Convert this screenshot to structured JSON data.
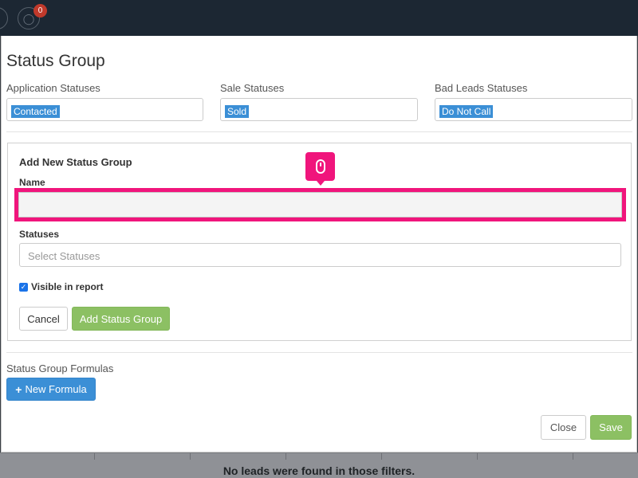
{
  "topbar": {
    "notification_count": "0"
  },
  "modal": {
    "title": "Status Group",
    "status_columns": [
      {
        "label": "Application Statuses",
        "tag": "Contacted"
      },
      {
        "label": "Sale Statuses",
        "tag": "Sold"
      },
      {
        "label": "Bad Leads Statuses",
        "tag": "Do Not Call"
      }
    ],
    "add_panel": {
      "title": "Add New Status Group",
      "name_label": "Name",
      "name_value": "",
      "statuses_label": "Statuses",
      "statuses_placeholder": "Select Statuses",
      "visible_label": "Visible in report",
      "visible_checked": true,
      "cancel_label": "Cancel",
      "add_label": "Add Status Group"
    },
    "formulas": {
      "label": "Status Group Formulas",
      "new_button_label": "New Formula",
      "new_button_icon": "plus-icon"
    },
    "footer": {
      "close_label": "Close",
      "save_label": "Save"
    }
  },
  "background": {
    "empty_message": "No leads were found in those filters."
  },
  "overlay": {
    "click_marker_icon": "mouse-icon"
  },
  "colors": {
    "accent_blue": "#3b8fd6",
    "success_green": "#8cc063",
    "highlight_pink": "#f0157c",
    "topbar_dark": "#1c2733",
    "badge_red": "#c0392b"
  }
}
